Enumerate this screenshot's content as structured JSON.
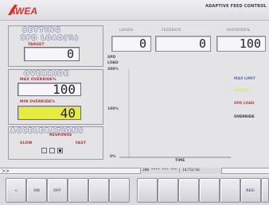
{
  "header": {
    "logo_text": "AWEA",
    "title": "ADAPTIVE FEED CONTROL"
  },
  "top_readouts": [
    {
      "label": "LOAD%",
      "value": "0"
    },
    {
      "label": "FEEDRATE",
      "value": "0"
    },
    {
      "label": "OVERRIDE%",
      "value": "100"
    }
  ],
  "setting": {
    "title": "SETTING",
    "subtitle": "SPD LOAD(%)",
    "target_label": "TARGET",
    "target_value": "0"
  },
  "override": {
    "title": "OVERRIDE",
    "max_label": "MAX OVERRIDE%",
    "max_value": "100",
    "min_label": "MIN OVERRIDE%",
    "min_value": "40",
    "highlight_color": "#e6ec3c"
  },
  "acceleration": {
    "title": "ACCELERATIONS",
    "response_label": "RESPONSE",
    "slow_label": "SLOW",
    "fast_label": "FAST",
    "selected_index": 2
  },
  "chart": {
    "axis_title_1": "SPD",
    "axis_title_2": "LOAD",
    "y_top": "200%",
    "y_mid": "100%",
    "y_bottom": "0%",
    "x_label": "TIME",
    "legend": [
      {
        "label": "MAX LIMIT",
        "color": "#5a6ac0"
      },
      {
        "label": "TARGET",
        "color": "#e8e070"
      },
      {
        "label": "SPD LOAD",
        "color": "#c04040"
      },
      {
        "label": "OVERRIDE",
        "color": "#303040"
      }
    ]
  },
  "status_bar": {
    "prompt": ">>",
    "time_left": "200",
    "time_mid": "**** *** ***",
    "time_right": "14/53/16"
  },
  "softkeys": [
    "<",
    "ON",
    "OFF",
    "",
    "",
    "",
    "",
    "",
    "",
    "",
    "",
    "RES-",
    ""
  ]
}
